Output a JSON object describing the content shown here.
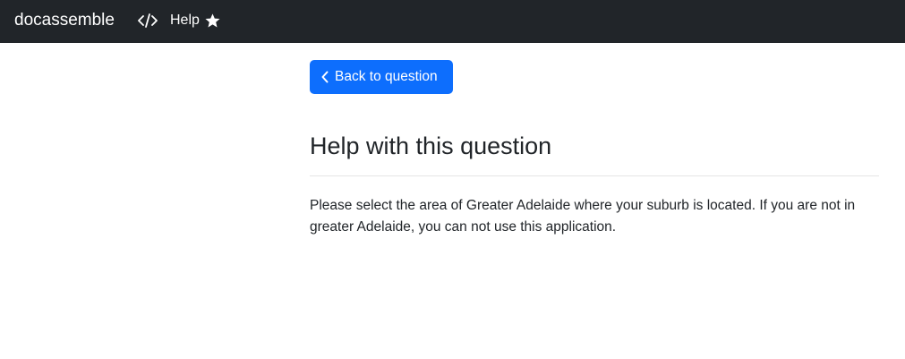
{
  "navbar": {
    "brand": "docassemble",
    "source_icon": "code-icon",
    "help_label": "Help",
    "help_icon": "star-icon"
  },
  "main": {
    "back_button_label": "Back to question",
    "back_button_icon": "chevron-left-icon",
    "title": "Help with this question",
    "help_text": "Please select the area of Greater Adelaide where your suburb is located. If you are not in greater Adelaide, you can not use this application."
  },
  "colors": {
    "navbar_bg": "#212529",
    "button_bg": "#0d6efd",
    "text": "#212529"
  }
}
